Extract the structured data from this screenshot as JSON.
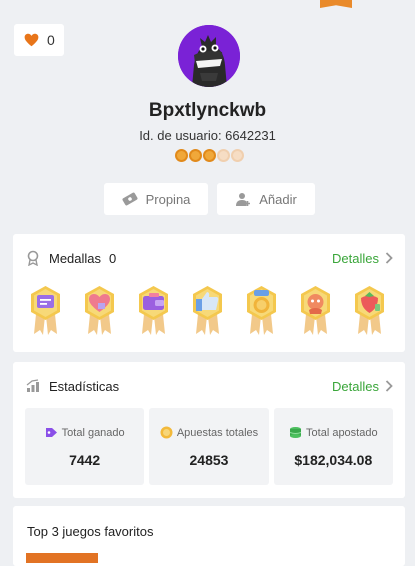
{
  "profile": {
    "likes": "0",
    "username": "Bpxtlynckwb",
    "user_id": "Id. de usuario: 6642231",
    "level_filled": 3,
    "level_total": 5
  },
  "actions": {
    "tip_label": "Propina",
    "add_label": "Añadir"
  },
  "medals": {
    "title": "Medallas",
    "count": "0",
    "details_label": "Detalles",
    "items": [
      "chat-medal-icon",
      "heart-medal-icon",
      "wallet-medal-icon",
      "thumbs-up-medal-icon",
      "coin-medal-icon",
      "character-medal-icon",
      "strawberry-medal-icon"
    ]
  },
  "stats": {
    "title": "Estadísticas",
    "details_label": "Detalles",
    "items": [
      {
        "label": "Total ganado",
        "value": "7442"
      },
      {
        "label": "Apuestas totales",
        "value": "24853"
      },
      {
        "label": "Total apostado",
        "value": "$182,034.08"
      }
    ]
  },
  "favorites": {
    "title": "Top 3 juegos favoritos"
  },
  "colors": {
    "accent_green": "#3aa63a",
    "brand_orange": "#e98a2a",
    "avatar_purple": "#7a22d6"
  }
}
